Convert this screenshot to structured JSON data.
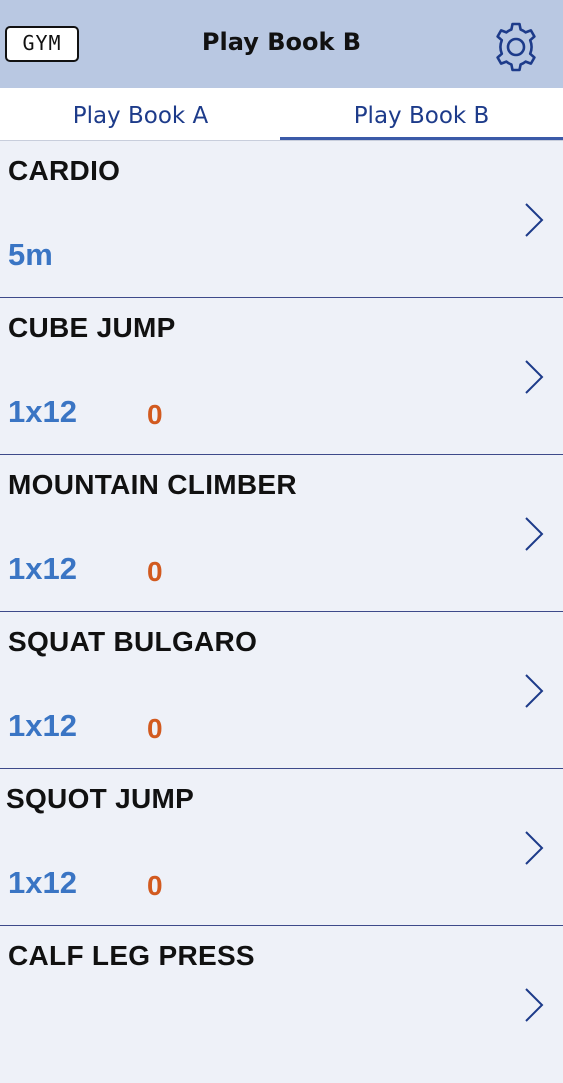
{
  "header": {
    "logo_text": "GYM",
    "title": "Play Book B",
    "settings_icon": "gear-icon"
  },
  "tabs": [
    {
      "label": "Play Book A",
      "active": false
    },
    {
      "label": "Play Book B",
      "active": true
    }
  ],
  "exercises": [
    {
      "name": "CARDIO",
      "sets": "5m",
      "count": ""
    },
    {
      "name": "CUBE JUMP",
      "sets": "1x12",
      "count": "0"
    },
    {
      "name": "MOUNTAIN CLIMBER",
      "sets": "1x12",
      "count": "0"
    },
    {
      "name": "SQUAT BULGARO",
      "sets": "1x12",
      "count": "0"
    },
    {
      "name": "SQUOT JUMP",
      "sets": "1x12",
      "count": "0"
    },
    {
      "name": "CALF LEG PRESS",
      "sets": "",
      "count": ""
    }
  ],
  "colors": {
    "header_bg": "#b9c8e2",
    "accent": "#1d3b8a",
    "sets_blue": "#3a75c4",
    "count_orange": "#d25a1f"
  }
}
